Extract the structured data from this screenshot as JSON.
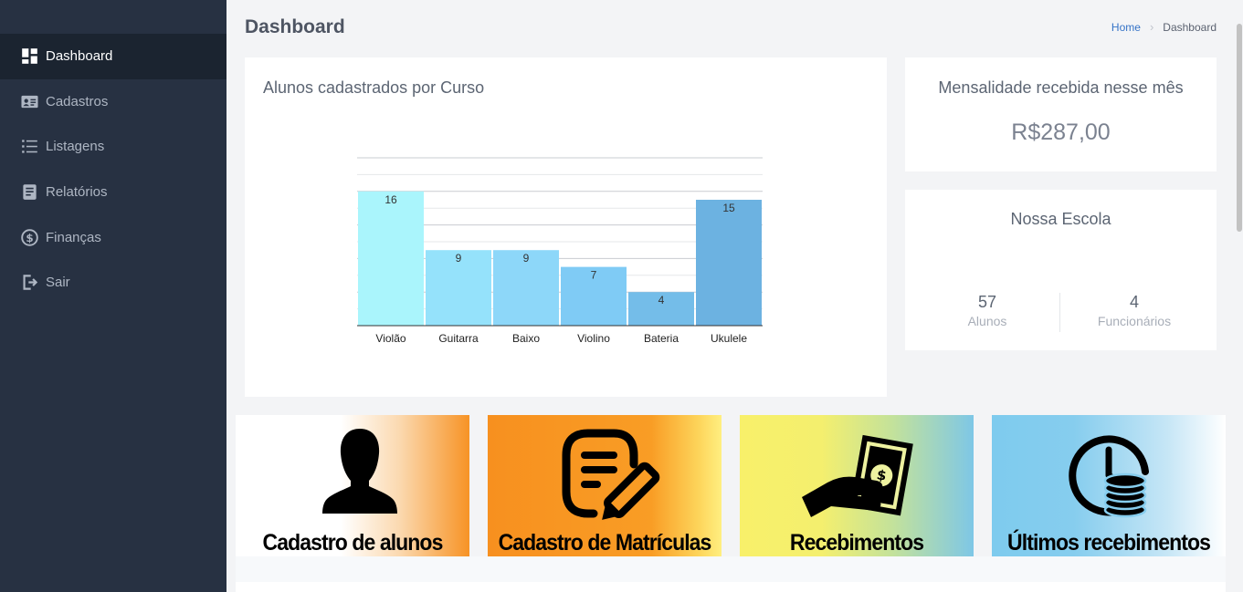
{
  "sidebar": {
    "items": [
      {
        "label": "Dashboard",
        "icon": "dashboard-icon",
        "active": true
      },
      {
        "label": "Cadastros",
        "icon": "id-card-icon"
      },
      {
        "label": "Listagens",
        "icon": "list-icon"
      },
      {
        "label": "Relatórios",
        "icon": "report-icon"
      },
      {
        "label": "Finanças",
        "icon": "dollar-circle-icon"
      },
      {
        "label": "Sair",
        "icon": "sign-out-icon"
      }
    ]
  },
  "header": {
    "title": "Dashboard",
    "breadcrumb": {
      "home": "Home",
      "current": "Dashboard"
    }
  },
  "chart_card": {
    "title": "Alunos cadastrados por Curso"
  },
  "chart_data": {
    "type": "bar",
    "categories": [
      "Violão",
      "Guitarra",
      "Baixo",
      "Violino",
      "Bateria",
      "Ukulele"
    ],
    "values": [
      16,
      9,
      9,
      7,
      4,
      15
    ],
    "colors": [
      "#aaf5fc",
      "#95e2fb",
      "#8dd7f9",
      "#7fcbf5",
      "#74bde9",
      "#6cb2e1"
    ],
    "ylim": [
      0,
      20
    ],
    "grid": true,
    "data_labels": true
  },
  "mensalidade": {
    "title": "Mensalidade recebida nesse mês",
    "value": "R$287,00"
  },
  "escola": {
    "title": "Nossa Escola",
    "alunos_value": "57",
    "alunos_label": "Alunos",
    "funcionarios_value": "4",
    "funcionarios_label": "Funcionários"
  },
  "tiles": [
    {
      "label": "Cadastro de alunos",
      "icon": "person-silhouette-icon"
    },
    {
      "label": "Cadastro de Matrículas",
      "icon": "document-edit-icon"
    },
    {
      "label": "Recebimentos",
      "icon": "hand-money-icon"
    },
    {
      "label": "Últimos recebimentos",
      "icon": "clock-coins-icon"
    }
  ]
}
